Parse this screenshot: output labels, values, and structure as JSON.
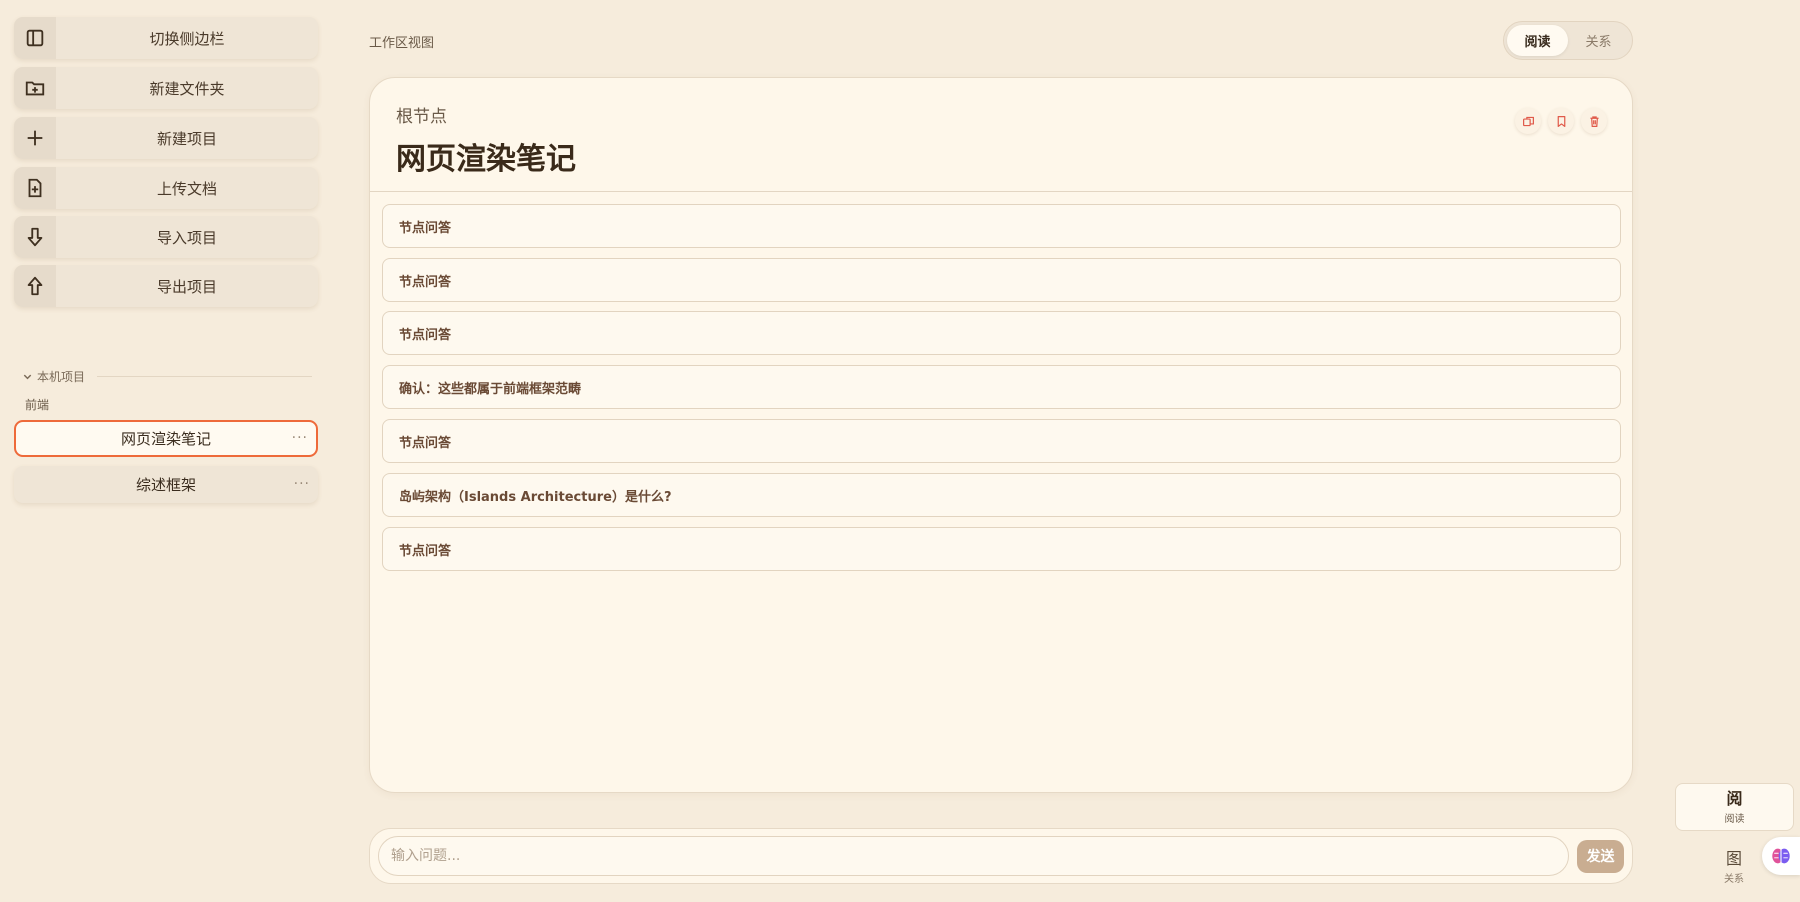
{
  "sidebar": {
    "actions": [
      {
        "label": "切换侧边栏",
        "icon": "sidebar-toggle-icon"
      },
      {
        "label": "新建文件夹",
        "icon": "folder-plus-icon"
      },
      {
        "label": "新建项目",
        "icon": "plus-icon"
      },
      {
        "label": "上传文档",
        "icon": "file-plus-icon"
      },
      {
        "label": "导入项目",
        "icon": "arrow-down-icon"
      },
      {
        "label": "导出项目",
        "icon": "arrow-up-icon"
      }
    ],
    "section_title": "本机项目",
    "folder": "前端",
    "projects": [
      {
        "label": "网页渲染笔记",
        "active": true,
        "more": "···"
      },
      {
        "label": "综述框架",
        "active": false,
        "more": "···"
      }
    ]
  },
  "main": {
    "workspace_label": "工作区视图",
    "view_toggle": {
      "read": "阅读",
      "relation": "关系"
    },
    "card": {
      "kicker": "根节点",
      "title": "网页渲染笔记",
      "tools": [
        "copy-icon",
        "bookmark-icon",
        "trash-icon"
      ],
      "items": [
        "节点问答",
        "节点问答",
        "节点问答",
        "确认：这些都属于前端框架范畴",
        "节点问答",
        "岛屿架构（Islands Architecture）是什么?",
        "节点问答"
      ]
    },
    "composer": {
      "placeholder": "输入问题...",
      "send": "发送"
    }
  },
  "dock": {
    "read": {
      "big": "阅",
      "small": "阅读"
    },
    "graph": {
      "big": "图",
      "small": "关系"
    }
  },
  "colors": {
    "background": "#f6ecdc",
    "accent": "#ee6a3a",
    "danger_icon": "#e05a4a",
    "send_button": "#c9ad91"
  }
}
